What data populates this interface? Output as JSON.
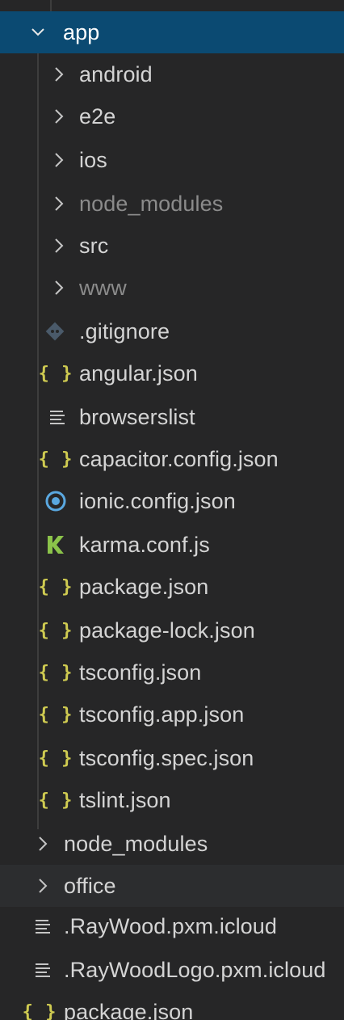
{
  "colors": {
    "background": "#262627",
    "selection": "#0b4a72",
    "hover": "#2c2d2f",
    "text": "#d4d4d4",
    "dim_text": "#8b8b8b",
    "json_icon": "#cfcb51",
    "git_icon": "#4a5a6a",
    "ionic_icon": "#5aa8e0",
    "karma_icon": "#8bc34a"
  },
  "tree": {
    "top_partial": "",
    "app": {
      "label": "app",
      "icon": "chevron-down-icon"
    },
    "app_children": [
      {
        "label": "android",
        "icon": "chevron-right-icon"
      },
      {
        "label": "e2e",
        "icon": "chevron-right-icon"
      },
      {
        "label": "ios",
        "icon": "chevron-right-icon"
      },
      {
        "label": "node_modules",
        "icon": "chevron-right-icon"
      },
      {
        "label": "src",
        "icon": "chevron-right-icon"
      },
      {
        "label": "www",
        "icon": "chevron-right-icon"
      },
      {
        "label": ".gitignore",
        "icon": "git-icon"
      },
      {
        "label": "angular.json",
        "icon": "json-icon"
      },
      {
        "label": "browserslist",
        "icon": "lines-icon"
      },
      {
        "label": "capacitor.config.json",
        "icon": "json-icon"
      },
      {
        "label": "ionic.config.json",
        "icon": "ionic-icon"
      },
      {
        "label": "karma.conf.js",
        "icon": "karma-icon"
      },
      {
        "label": "package.json",
        "icon": "json-icon"
      },
      {
        "label": "package-lock.json",
        "icon": "json-icon"
      },
      {
        "label": "tsconfig.json",
        "icon": "json-icon"
      },
      {
        "label": "tsconfig.app.json",
        "icon": "json-icon"
      },
      {
        "label": "tsconfig.spec.json",
        "icon": "json-icon"
      },
      {
        "label": "tslint.json",
        "icon": "json-icon"
      }
    ],
    "root_items": [
      {
        "label": "node_modules",
        "icon": "chevron-right-icon"
      },
      {
        "label": "office",
        "icon": "chevron-right-icon"
      },
      {
        "label": ".RayWood.pxm.icloud",
        "icon": "lines-icon"
      },
      {
        "label": ".RayWoodLogo.pxm.icloud",
        "icon": "lines-icon"
      },
      {
        "label": "package.json",
        "icon": "json-icon"
      }
    ],
    "json_glyph": "{ }"
  }
}
